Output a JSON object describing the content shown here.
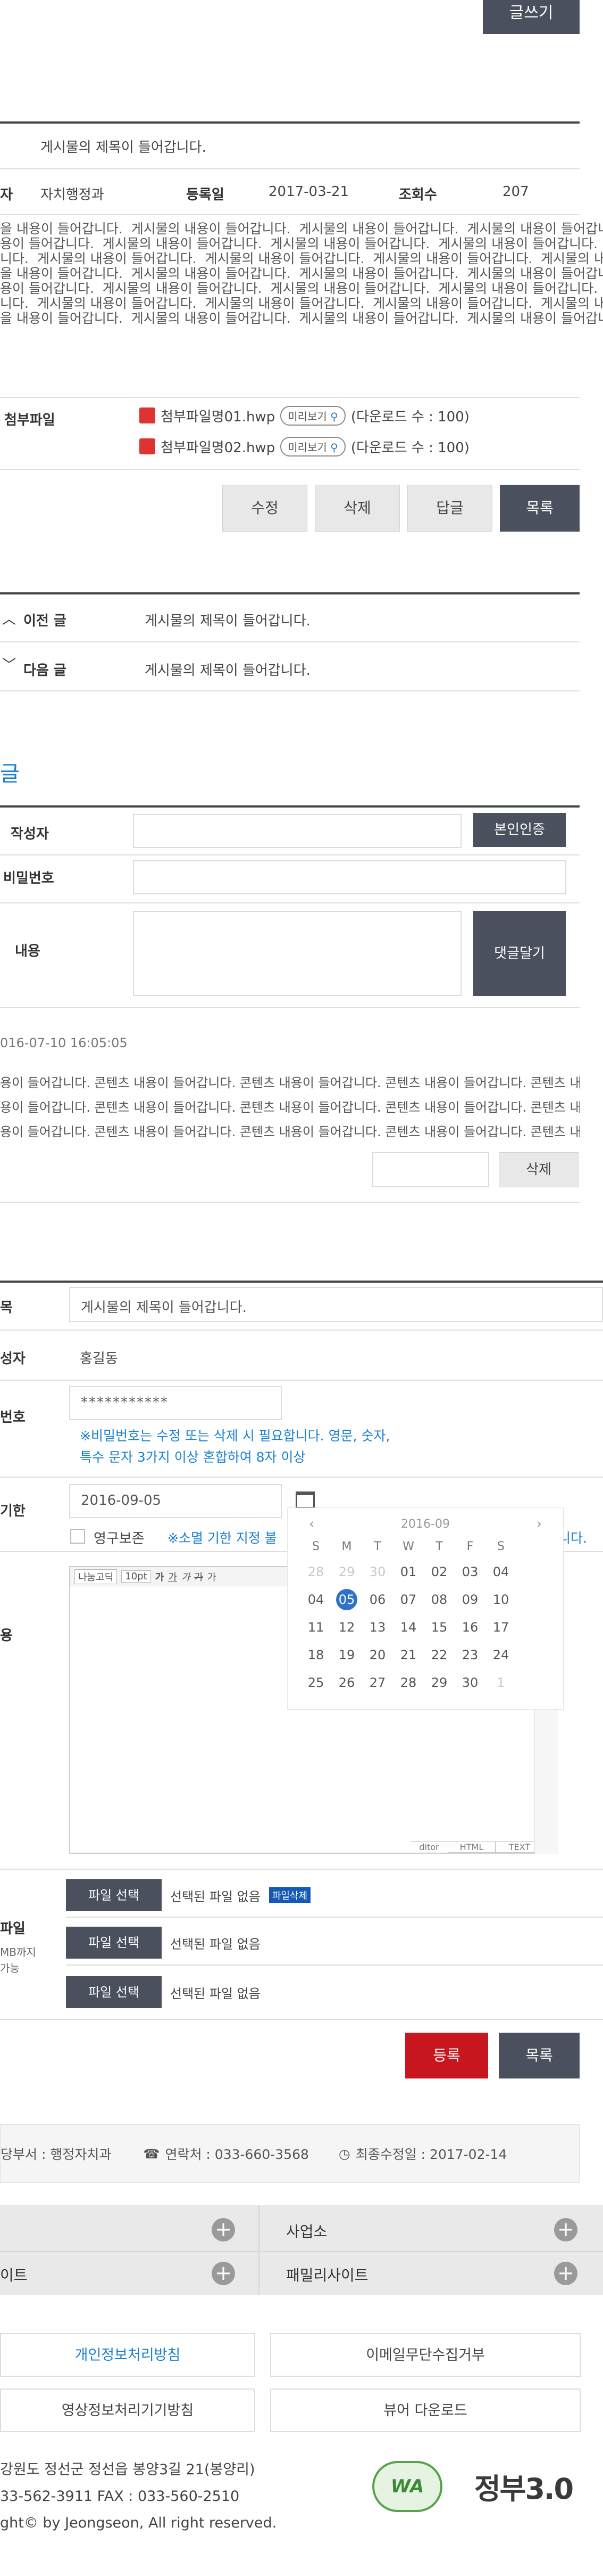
{
  "write_button": "글쓰기",
  "post": {
    "title": "게시물의 제목이 들어갑니다.",
    "dept_label": "자치행정과",
    "regdate_label": "등록일",
    "regdate": "2017-03-21",
    "views_label": "조회수",
    "views": "207",
    "author_label_frag": "자",
    "body_lines": [
      "을 내용이 들어갑니다.  게시물의 내용이 들어갑니다.  게시물의 내용이 들어갑니다.  게시물의 내용이 들어갑니다.  게시물의 내용이 들어갑니다.  게시물의",
      "용이 들어갑니다.  게시물의 내용이 들어갑니다.  게시물의 내용이 들어갑니다.  게시물의 내용이 들어갑니다.  게시물의 내용이 들어갑니다.  게시물의 내용이",
      "니다.  게시물의 내용이 들어갑니다.  게시물의 내용이 들어갑니다.  게시물의 내용이 들어갑니다.  게시물의 내용이 들어갑니다.  게시물의 내용이 들어갑니다.",
      "을 내용이 들어갑니다.  게시물의 내용이 들어갑니다.  게시물의 내용이 들어갑니다.  게시물의 내용이 들어갑니다.  게시물의 내용이 들어갑니다.  게시물의",
      "용이 들어갑니다.  게시물의 내용이 들어갑니다.  게시물의 내용이 들어갑니다.  게시물의 내용이 들어갑니다.  게시물의 내용이 들어갑니다.  게시물의 내용이",
      "니다.  게시물의 내용이 들어갑니다.  게시물의 내용이 들어갑니다.  게시물의 내용이 들어갑니다.  게시물의 내용이 들어갑니다.  게시물의 내용이 들어갑니다.",
      "을 내용이 들어갑니다.  게시물의 내용이 들어갑니다.  게시물의 내용이 들어갑니다.  게시물의 내용이 들어갑니다.  게시물의 내용이 들어갑니다.  게시물의"
    ],
    "attach_label": "첨부파일",
    "files": [
      {
        "name": "첨부파일명01.hwp",
        "preview": "미리보기",
        "count": "(다운로드 수 : 100)"
      },
      {
        "name": "첨부파일명02.hwp",
        "preview": "미리보기",
        "count": "(다운로드 수 : 100)"
      }
    ],
    "actions": [
      "수정",
      "삭제",
      "답글",
      "목록"
    ],
    "prev_label": "이전 글",
    "prev_title": "게시물의 제목이 들어갑니다.",
    "next_label": "다음 글",
    "next_title": "게시물의 제목이 들어갑니다."
  },
  "comment": {
    "heading": "글",
    "writer_label": "작성자",
    "verify_btn": "본인인증",
    "password_label": "비밀번호",
    "content_label": "내용",
    "submit_btn": "댓글달기",
    "date": "016-07-10 16:05:05",
    "lines": [
      "용이 들어갑니다. 콘텐츠 내용이 들어갑니다. 콘텐츠 내용이 들어갑니다. 콘텐츠 내용이 들어갑니다. 콘텐츠 내용이 들어갑니다.",
      "용이 들어갑니다. 콘텐츠 내용이 들어갑니다. 콘텐츠 내용이 들어갑니다. 콘텐츠 내용이 들어갑니다. 콘텐츠 내용이 들어갑니다.",
      "용이 들어갑니다. 콘텐츠 내용이 들어갑니다. 콘텐츠 내용이 들어갑니다. 콘텐츠 내용이 들어갑니다. 콘텐츠 내용이 들어갑니다."
    ],
    "delete_btn": "삭제"
  },
  "form": {
    "title_label": "목",
    "title_value": "게시물의 제목이 들어갑니다.",
    "author_label": "성자",
    "author_value": "홍길동",
    "pw_label": "번호",
    "pw_value": "***********",
    "pw_note1": "※비밀번호는 수정 또는 삭제 시 필요합니다. 영문, 숫자,",
    "pw_note2": "특수 문자 3가지 이상 혼합하여 8자 이상",
    "period_label": "기한",
    "date_value": "2016-09-05",
    "permanent_label": "영구보존",
    "expire_note": "※소멸 기한 지정 불",
    "expire_note_tail": "니다.",
    "content_label": "용",
    "editor_font": "나눔고딕",
    "editor_size": "10pt",
    "editor_modes": [
      "ditor",
      "HTML",
      "TEXT"
    ],
    "file_label": "파일",
    "file_note1": "MB까지",
    "file_note2": "가능",
    "file_btn": "파일 선택",
    "file_none": "선택된 파일 없음",
    "file_delete": "파일삭제",
    "register_btn": "등록",
    "list_btn": "목록"
  },
  "calendar": {
    "month": "2016-09",
    "weekdays": [
      "S",
      "M",
      "T",
      "W",
      "T",
      "F",
      "S"
    ],
    "weeks": [
      [
        "28",
        "29",
        "30",
        "01",
        "02",
        "03",
        "04"
      ],
      [
        "04",
        "05",
        "06",
        "07",
        "08",
        "09",
        "10"
      ],
      [
        "11",
        "12",
        "13",
        "14",
        "15",
        "16",
        "17"
      ],
      [
        "18",
        "19",
        "20",
        "21",
        "22",
        "23",
        "24"
      ],
      [
        "25",
        "26",
        "27",
        "28",
        "29",
        "30",
        "1"
      ]
    ],
    "selected": "05"
  },
  "info": {
    "dept": "당부서 : 행정자치과",
    "contact": "연락처 : 033-660-3568",
    "updated": "최종수정일 : 2017-02-14"
  },
  "footer": {
    "links_left": [
      "",
      "이트"
    ],
    "links_right": [
      "사업소",
      "패밀리사이트"
    ],
    "policy": [
      "개인정보처리방침",
      "이메일무단수집거부",
      "영상정보처리기기방침",
      "뷰어 다운로드"
    ],
    "address": "강원도 정선군 정선읍 봉양3길 21(봉양리)",
    "phone": "33-562-3911     FAX : 033-560-2510",
    "copyright": "ght© by Jeongseon, All right reserved.",
    "gov_logo": "정부3.0",
    "wa_logo": "WA"
  }
}
